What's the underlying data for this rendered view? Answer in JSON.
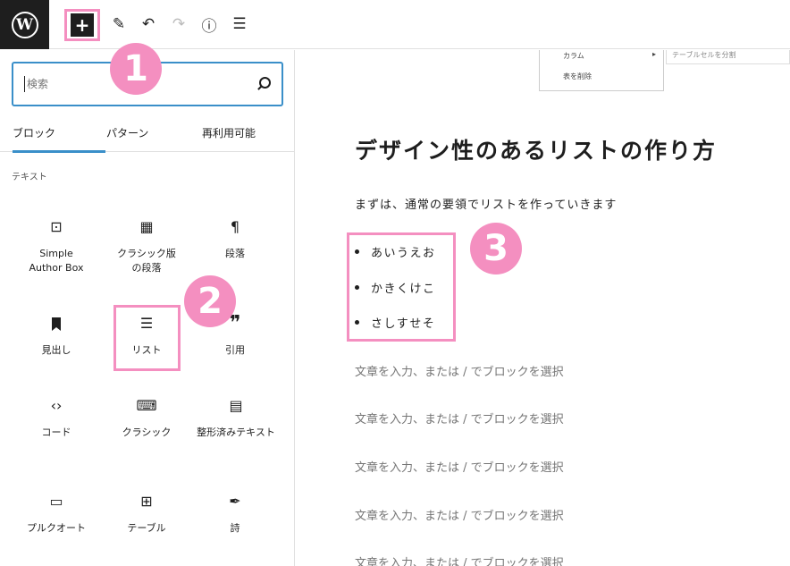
{
  "toolbar": {
    "logo": "W",
    "add_icon": "+",
    "tools": [
      {
        "name": "pencil-icon",
        "glyph": "✎"
      },
      {
        "name": "undo-icon",
        "glyph": "↶"
      },
      {
        "name": "redo-icon",
        "glyph": "↷"
      },
      {
        "name": "info-icon",
        "glyph": "ⓘ"
      },
      {
        "name": "list-view-icon",
        "glyph": "☰"
      }
    ]
  },
  "badges": [
    "1",
    "2",
    "3"
  ],
  "sidebar": {
    "search_placeholder": "検索",
    "tabs": [
      "ブロック",
      "パターン",
      "再利用可能"
    ],
    "section_label": "テキスト",
    "blocks": [
      {
        "label": "Simple\nAuthor Box",
        "icon": "⊡"
      },
      {
        "label": "クラシック版\nの段落",
        "icon": "▦"
      },
      {
        "label": "段落",
        "icon": "¶"
      },
      {
        "label": "見出し",
        "icon": "🔖"
      },
      {
        "label": "リスト",
        "icon": "☰"
      },
      {
        "label": "引用",
        "icon": "❞"
      },
      {
        "label": "コード",
        "icon": "‹›"
      },
      {
        "label": "クラシック",
        "icon": "⌨"
      },
      {
        "label": "整形済みテキスト",
        "icon": "▤"
      },
      {
        "label": "プルクオート",
        "icon": "▭"
      },
      {
        "label": "テーブル",
        "icon": "⊞"
      },
      {
        "label": "詩",
        "icon": "✒"
      }
    ]
  },
  "editor": {
    "dropdown": {
      "item1": "カラム",
      "item1_arrow": "▸",
      "item2": "表を削除",
      "submenu": "テーブルセルを分割"
    },
    "title": "デザイン性のあるリストの作り方",
    "intro": "まずは、通常の要領でリストを作っていきます",
    "list_items": [
      "あいうえお",
      "かきくけこ",
      "さしすせそ"
    ],
    "placeholder": "文章を入力、または / でブロックを選択",
    "placeholder_count": 5
  },
  "colors": {
    "accent": "#3a8fc9",
    "highlight": "#f48fc0",
    "dark": "#1e1e1e"
  }
}
